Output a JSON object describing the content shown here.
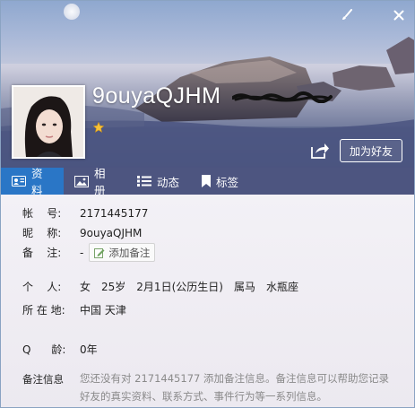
{
  "profile": {
    "nickname": "9ouyaQJHM",
    "add_friend_label": "加为好友"
  },
  "tabs": [
    {
      "label": "资料",
      "icon": "id-card-icon",
      "active": true
    },
    {
      "label": "相册",
      "icon": "photo-icon",
      "active": false
    },
    {
      "label": "动态",
      "icon": "list-icon",
      "active": false
    },
    {
      "label": "标签",
      "icon": "bookmark-icon",
      "active": false
    }
  ],
  "info": {
    "account_label": "帐    号:",
    "account_value": "2171445177",
    "nick_label": "昵    称:",
    "nick_value": "9ouyaQJHM",
    "remark_label": "备    注:",
    "remark_value": "-",
    "add_remark_label": "添加备注",
    "personal_label": "个    人:",
    "gender": "女",
    "age": "25岁",
    "birthday": "2月1日(公历生日)",
    "zodiac": "属马",
    "constellation": "水瓶座",
    "location_label": "所 在 地:",
    "location_value": "中国 天津",
    "qage_label": "Q      龄:",
    "qage_value": "0年",
    "note_info_label": "备注信息",
    "note_info_text": "您还没有对 2171445177 添加备注信息。备注信息可以帮助您记录好友的真实资料、联系方式、事件行为等一系列信息。"
  },
  "colors": {
    "tab_bar": "#4d5580",
    "tab_active": "#2a76c6"
  }
}
